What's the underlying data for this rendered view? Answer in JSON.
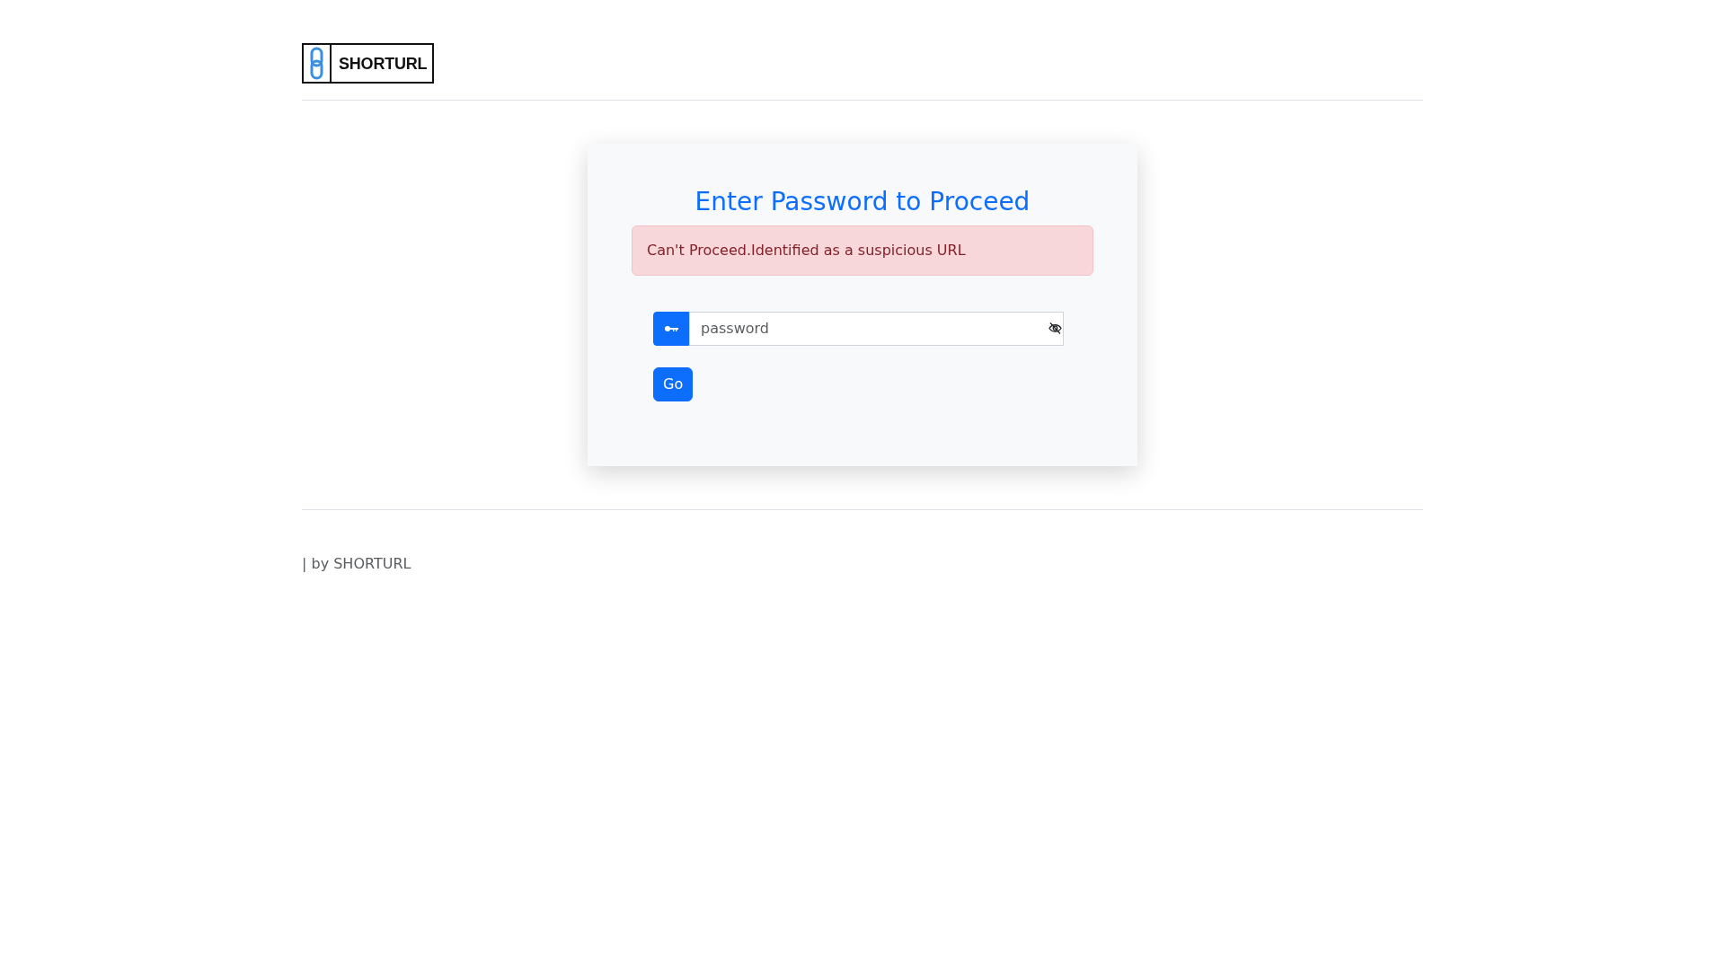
{
  "header": {
    "logo": {
      "text": "SHORTURL"
    }
  },
  "card": {
    "title": "Enter Password to Proceed",
    "alert": {
      "kind": "danger",
      "text": "Can't Proceed.Identified as a suspicious URL"
    },
    "password_field": {
      "placeholder": "password",
      "password_visible": false
    },
    "submit_button": "Go"
  },
  "footer": {
    "text": "| by SHORTURL"
  }
}
